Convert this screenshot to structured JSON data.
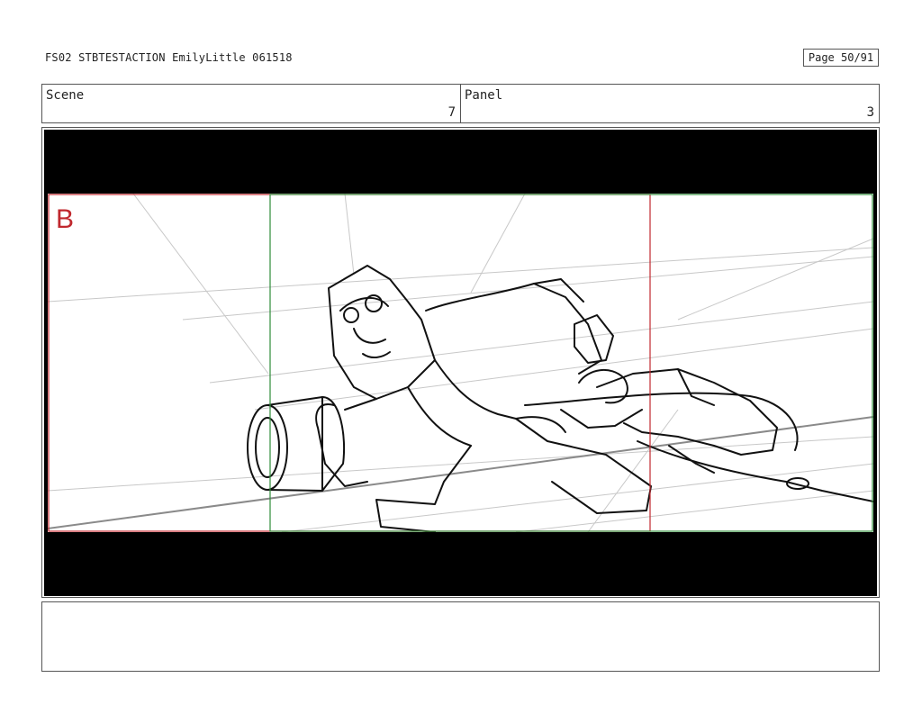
{
  "header": {
    "title": "FS02 STBTESTACTION EmilyLittle 061518",
    "page": "Page 50/91"
  },
  "info": {
    "scene_label": "Scene",
    "scene_value": "7",
    "panel_label": "Panel",
    "panel_value": "3"
  },
  "frame": {
    "marker": "B",
    "colors": {
      "safe_red": "#c0282e",
      "guide_green": "#2e8b3a",
      "letterbox": "#000000"
    }
  },
  "notes": {
    "text": ""
  }
}
